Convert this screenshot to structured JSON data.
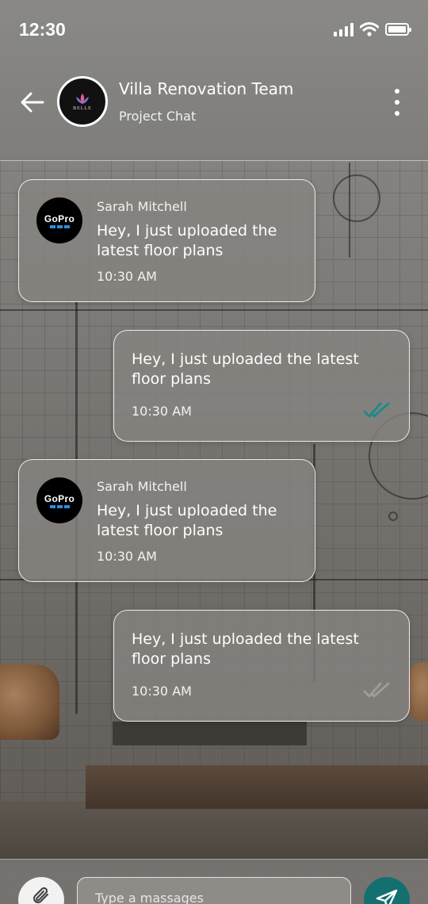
{
  "status_bar": {
    "time": "12:30",
    "icons": [
      "signal-icon",
      "wifi-icon",
      "battery-icon"
    ]
  },
  "header": {
    "title": "Villa Renovation Team",
    "subtitle": "Project Chat",
    "avatar_brand": "BELLE",
    "icons": [
      "back-arrow-icon",
      "more-vertical-icon"
    ]
  },
  "messages": [
    {
      "direction": "incoming",
      "sender": "Sarah Mitchell",
      "avatar_logo": "GoPro",
      "text": "Hey, I just uploaded the latest floor plans",
      "time": "10:30 AM"
    },
    {
      "direction": "outgoing",
      "text": "Hey, I just uploaded the latest floor plans",
      "time": "10:30 AM",
      "read": true
    },
    {
      "direction": "incoming",
      "sender": "Sarah Mitchell",
      "avatar_logo": "GoPro",
      "text": "Hey, I just uploaded the latest floor plans",
      "time": "10:30 AM"
    },
    {
      "direction": "outgoing",
      "text": "Hey, I just uploaded the latest floor plans",
      "time": "10:30 AM",
      "read": false
    }
  ],
  "composer": {
    "placeholder": "Type a massages",
    "icons": [
      "paperclip-icon",
      "send-icon"
    ]
  },
  "colors": {
    "accent": "#13706f",
    "read_tick": "#1f8a8a"
  }
}
